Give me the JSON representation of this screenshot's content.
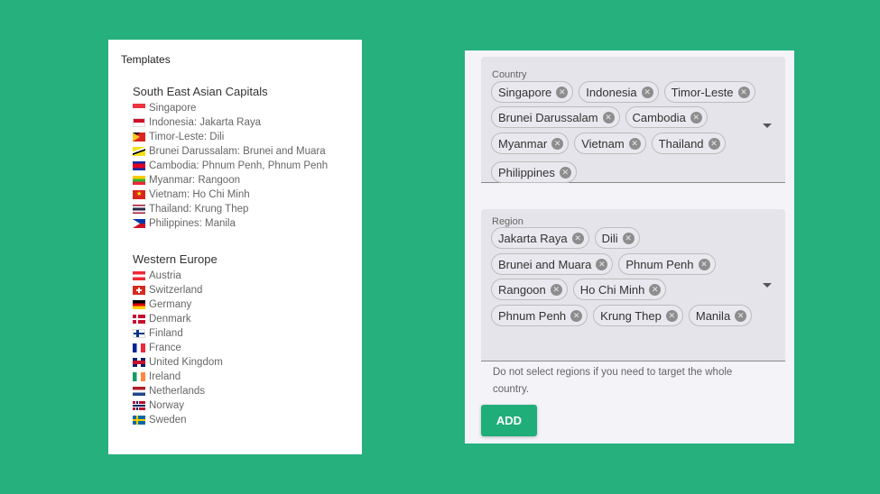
{
  "templates": {
    "title": "Templates",
    "groups": [
      {
        "title": "South East Asian Capitals",
        "items": [
          {
            "flag": "sg",
            "text": "Singapore"
          },
          {
            "flag": "id",
            "text": "Indonesia: Jakarta Raya"
          },
          {
            "flag": "tl",
            "text": "Timor-Leste: Dili"
          },
          {
            "flag": "bn",
            "text": "Brunei Darussalam: Brunei and Muara"
          },
          {
            "flag": "kh",
            "text": "Cambodia: Phnum Penh, Phnum Penh"
          },
          {
            "flag": "mm",
            "text": "Myanmar: Rangoon"
          },
          {
            "flag": "vn",
            "text": "Vietnam: Ho Chi Minh"
          },
          {
            "flag": "th",
            "text": "Thailand: Krung Thep"
          },
          {
            "flag": "ph",
            "text": "Philippines: Manila"
          }
        ]
      },
      {
        "title": "Western Europe",
        "items": [
          {
            "flag": "at",
            "text": "Austria"
          },
          {
            "flag": "ch",
            "text": "Switzerland"
          },
          {
            "flag": "de",
            "text": "Germany"
          },
          {
            "flag": "dk",
            "text": "Denmark"
          },
          {
            "flag": "fi",
            "text": "Finland"
          },
          {
            "flag": "fr",
            "text": "France"
          },
          {
            "flag": "gb",
            "text": "United Kingdom"
          },
          {
            "flag": "ie",
            "text": "Ireland"
          },
          {
            "flag": "nl",
            "text": "Netherlands"
          },
          {
            "flag": "no",
            "text": "Norway"
          },
          {
            "flag": "se",
            "text": "Sweden"
          }
        ]
      }
    ]
  },
  "form": {
    "country": {
      "label": "Country",
      "rows": [
        [
          "Singapore",
          "Indonesia",
          "Timor-Leste"
        ],
        [
          "Brunei Darussalam",
          "Cambodia"
        ],
        [
          "Myanmar",
          "Vietnam",
          "Thailand"
        ],
        [
          "Philippines"
        ]
      ]
    },
    "region": {
      "label": "Region",
      "rows": [
        [
          "Jakarta Raya",
          "Dili"
        ],
        [
          "Brunei and Muara",
          "Phnum Penh"
        ],
        [
          "Rangoon",
          "Ho Chi Minh"
        ],
        [
          "Phnum Penh",
          "Krung Thep",
          "Manila"
        ]
      ]
    },
    "hint": "Do not select regions if you need to target the whole country.",
    "add_label": "ADD",
    "accent_color": "#1fae7a"
  }
}
